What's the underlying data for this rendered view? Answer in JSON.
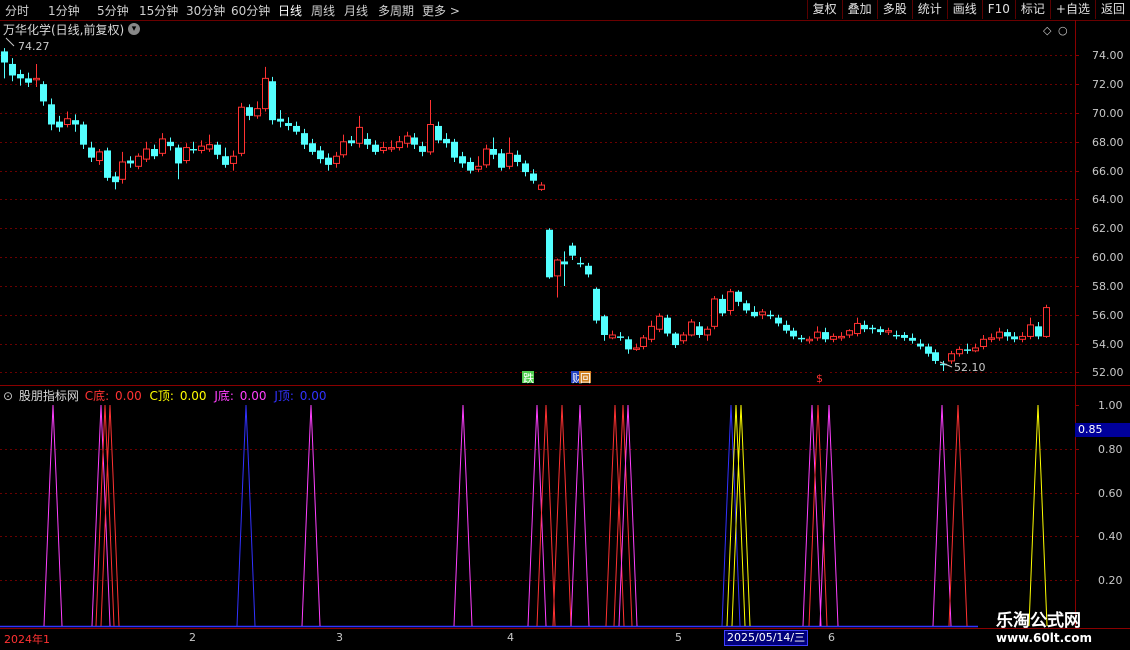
{
  "toolbar": {
    "left": [
      "分时",
      "1分钟",
      "5分钟",
      "15分钟",
      "30分钟",
      "60分钟",
      "日线",
      "周线",
      "月线",
      "多周期",
      "更多 >"
    ],
    "right": [
      "复权",
      "叠加",
      "多股",
      "统计",
      "画线",
      "F10",
      "标记",
      "+自选",
      "返回"
    ]
  },
  "chart_title": "万华化学(日线,前复权)",
  "price_axis": [
    "74.00",
    "72.00",
    "70.00",
    "68.00",
    "66.00",
    "64.00",
    "62.00",
    "60.00",
    "58.00",
    "56.00",
    "54.00",
    "52.00"
  ],
  "price_annotations": {
    "high": "74.27",
    "low": "52.10"
  },
  "event_markers": [
    "跌",
    "财",
    "回",
    "$"
  ],
  "indicator": {
    "name": "股朋指标网",
    "c_bottom_label": "C底:",
    "c_bottom_value": "0.00",
    "c_top_label": "C顶:",
    "c_top_value": "0.00",
    "j_bottom_label": "J底:",
    "j_bottom_value": "0.00",
    "j_top_label": "J顶:",
    "j_top_value": "0.00",
    "axis": [
      "1.00",
      "0.80",
      "0.60",
      "0.40",
      "0.20"
    ],
    "current_value": "0.85"
  },
  "date_axis": {
    "labels": [
      "2024年1",
      "2",
      "3",
      "4",
      "5",
      "6"
    ],
    "cursor_date": "2025/05/14/三"
  },
  "watermark": {
    "title": "乐淘公式网",
    "url": "www.60lt.com"
  },
  "colors": {
    "up": "#ff3232",
    "down": "#54ffff",
    "c_bottom": "#ff3232",
    "c_top": "#ffff00",
    "j_bottom": "#ff40ff",
    "j_top": "#3232ff"
  },
  "chart_data": {
    "type": "candlestick",
    "candles": [
      [
        74.27,
        73.5,
        74.5,
        72.4
      ],
      [
        73.4,
        72.6,
        73.8,
        72.2
      ],
      [
        72.7,
        72.4,
        73.0,
        71.9
      ],
      [
        72.4,
        72.1,
        72.8,
        71.8
      ],
      [
        72.3,
        72.4,
        73.4,
        71.8
      ],
      [
        72.0,
        70.8,
        72.2,
        70.5
      ],
      [
        70.6,
        69.2,
        71.0,
        68.8
      ],
      [
        69.4,
        69.0,
        69.8,
        68.7
      ],
      [
        69.2,
        69.6,
        70.1,
        69.0
      ],
      [
        69.5,
        69.2,
        69.9,
        68.7
      ],
      [
        69.2,
        67.8,
        69.4,
        67.5
      ],
      [
        67.6,
        66.9,
        68.0,
        66.6
      ],
      [
        66.7,
        67.3,
        67.5,
        66.4
      ],
      [
        67.4,
        65.5,
        67.6,
        65.3
      ],
      [
        65.6,
        65.2,
        65.9,
        64.7
      ],
      [
        65.4,
        66.6,
        67.3,
        65.1
      ],
      [
        66.7,
        66.5,
        67.0,
        66.2
      ],
      [
        66.3,
        67.0,
        67.2,
        66.1
      ],
      [
        66.8,
        67.5,
        68.0,
        66.6
      ],
      [
        67.5,
        67.0,
        67.8,
        66.8
      ],
      [
        67.2,
        68.2,
        68.6,
        67.0
      ],
      [
        68.0,
        67.7,
        68.3,
        67.4
      ],
      [
        67.6,
        66.5,
        67.8,
        65.4
      ],
      [
        66.7,
        67.6,
        67.9,
        66.5
      ],
      [
        67.5,
        67.4,
        68.0,
        67.2
      ],
      [
        67.4,
        67.7,
        68.1,
        67.2
      ],
      [
        67.5,
        67.8,
        68.5,
        67.3
      ],
      [
        67.8,
        67.1,
        68.0,
        66.8
      ],
      [
        67.0,
        66.4,
        67.6,
        66.2
      ],
      [
        66.5,
        67.0,
        67.4,
        66.0
      ],
      [
        67.2,
        70.4,
        70.7,
        67.0
      ],
      [
        70.4,
        69.8,
        70.6,
        69.5
      ],
      [
        69.8,
        70.3,
        70.8,
        69.6
      ],
      [
        70.3,
        72.4,
        73.2,
        70.1
      ],
      [
        72.2,
        69.5,
        72.5,
        69.2
      ],
      [
        69.6,
        69.4,
        70.2,
        69.0
      ],
      [
        69.3,
        69.1,
        69.7,
        68.8
      ],
      [
        69.1,
        68.7,
        69.4,
        68.5
      ],
      [
        68.6,
        67.8,
        68.9,
        67.5
      ],
      [
        67.9,
        67.3,
        68.2,
        67.1
      ],
      [
        67.4,
        66.8,
        67.7,
        66.5
      ],
      [
        66.9,
        66.4,
        67.2,
        66.0
      ],
      [
        66.5,
        67.0,
        67.3,
        66.2
      ],
      [
        67.1,
        68.0,
        68.5,
        66.9
      ],
      [
        68.1,
        67.9,
        68.4,
        67.7
      ],
      [
        67.9,
        69.0,
        69.8,
        67.6
      ],
      [
        68.2,
        67.8,
        68.6,
        67.5
      ],
      [
        67.8,
        67.3,
        68.1,
        67.1
      ],
      [
        67.4,
        67.6,
        68.0,
        67.2
      ],
      [
        67.5,
        67.6,
        68.1,
        67.3
      ],
      [
        67.6,
        68.0,
        68.4,
        67.4
      ],
      [
        67.9,
        68.4,
        68.7,
        67.6
      ],
      [
        68.3,
        67.8,
        68.6,
        67.5
      ],
      [
        67.7,
        67.3,
        68.0,
        67.0
      ],
      [
        67.3,
        69.2,
        70.9,
        67.1
      ],
      [
        69.1,
        68.1,
        69.4,
        67.9
      ],
      [
        68.2,
        67.9,
        68.6,
        67.6
      ],
      [
        68.0,
        66.9,
        68.2,
        66.6
      ],
      [
        67.0,
        66.5,
        67.3,
        66.2
      ],
      [
        66.6,
        66.0,
        66.9,
        65.8
      ],
      [
        66.1,
        66.3,
        67.0,
        65.9
      ],
      [
        66.4,
        67.5,
        67.8,
        66.2
      ],
      [
        67.5,
        67.1,
        68.3,
        66.8
      ],
      [
        67.2,
        66.2,
        67.5,
        66.0
      ],
      [
        66.3,
        67.2,
        68.3,
        66.1
      ],
      [
        67.1,
        66.6,
        67.4,
        66.3
      ],
      [
        66.5,
        65.9,
        66.7,
        65.6
      ],
      [
        65.8,
        65.3,
        66.1,
        65.1
      ],
      [
        64.7,
        65.0,
        65.2,
        64.6
      ],
      [
        61.9,
        58.6,
        62.0,
        58.5
      ],
      [
        58.7,
        59.8,
        59.9,
        57.2
      ],
      [
        59.7,
        59.5,
        60.4,
        58.0
      ],
      [
        60.8,
        60.1,
        61.0,
        59.8
      ],
      [
        59.6,
        59.5,
        60.0,
        59.3
      ],
      [
        59.4,
        58.8,
        59.6,
        58.6
      ],
      [
        57.8,
        55.6,
        57.9,
        55.4
      ],
      [
        55.9,
        54.6,
        56.0,
        54.2
      ],
      [
        54.4,
        54.6,
        54.9,
        54.3
      ],
      [
        54.5,
        54.4,
        54.8,
        54.2
      ],
      [
        54.3,
        53.6,
        54.5,
        53.3
      ],
      [
        53.6,
        53.7,
        54.0,
        53.5
      ],
      [
        53.8,
        54.4,
        54.6,
        53.6
      ],
      [
        54.3,
        55.2,
        55.6,
        54.1
      ],
      [
        55.0,
        55.9,
        56.1,
        54.8
      ],
      [
        55.8,
        54.7,
        56.0,
        54.5
      ],
      [
        54.7,
        53.9,
        54.8,
        53.7
      ],
      [
        54.2,
        54.6,
        54.8,
        54.0
      ],
      [
        54.6,
        55.5,
        55.7,
        54.5
      ],
      [
        55.2,
        54.6,
        55.5,
        54.4
      ],
      [
        54.6,
        55.0,
        55.2,
        54.2
      ],
      [
        55.2,
        57.1,
        57.3,
        55.0
      ],
      [
        57.1,
        56.1,
        57.4,
        55.9
      ],
      [
        56.3,
        57.6,
        57.8,
        56.0
      ],
      [
        57.6,
        56.9,
        57.7,
        56.6
      ],
      [
        56.8,
        56.3,
        57.0,
        56.1
      ],
      [
        56.2,
        55.9,
        56.6,
        55.8
      ],
      [
        56.0,
        56.2,
        56.4,
        55.7
      ],
      [
        56.0,
        55.9,
        56.3,
        55.7
      ],
      [
        55.8,
        55.4,
        56.0,
        55.2
      ],
      [
        55.3,
        54.9,
        55.6,
        54.7
      ],
      [
        54.9,
        54.5,
        55.1,
        54.3
      ],
      [
        54.4,
        54.3,
        54.6,
        54.1
      ],
      [
        54.2,
        54.3,
        54.5,
        54.0
      ],
      [
        54.4,
        54.8,
        55.2,
        54.2
      ],
      [
        54.8,
        54.3,
        55.1,
        54.1
      ],
      [
        54.3,
        54.5,
        54.7,
        54.1
      ],
      [
        54.4,
        54.5,
        54.8,
        54.2
      ],
      [
        54.6,
        54.9,
        55.0,
        54.4
      ],
      [
        54.7,
        55.4,
        55.8,
        54.5
      ],
      [
        55.3,
        55.0,
        55.6,
        54.8
      ],
      [
        55.1,
        55.0,
        55.3,
        54.7
      ],
      [
        55.0,
        54.8,
        55.2,
        54.6
      ],
      [
        54.8,
        54.9,
        55.1,
        54.6
      ],
      [
        54.6,
        54.5,
        54.9,
        54.3
      ],
      [
        54.6,
        54.4,
        54.8,
        54.2
      ],
      [
        54.4,
        54.2,
        54.7,
        54.0
      ],
      [
        54.0,
        53.8,
        54.3,
        53.6
      ],
      [
        53.8,
        53.3,
        54.0,
        53.1
      ],
      [
        53.4,
        52.8,
        53.6,
        52.6
      ],
      [
        52.6,
        52.5,
        52.8,
        52.1
      ],
      [
        52.8,
        53.3,
        53.5,
        52.6
      ],
      [
        53.3,
        53.6,
        53.8,
        53.1
      ],
      [
        53.6,
        53.5,
        54.0,
        53.3
      ],
      [
        53.5,
        53.7,
        54.0,
        53.4
      ],
      [
        53.8,
        54.3,
        54.6,
        53.6
      ],
      [
        54.3,
        54.4,
        54.7,
        54.1
      ],
      [
        54.4,
        54.8,
        55.1,
        54.2
      ],
      [
        54.8,
        54.5,
        55.0,
        54.2
      ],
      [
        54.5,
        54.3,
        54.8,
        54.1
      ],
      [
        54.3,
        54.5,
        54.8,
        54.1
      ],
      [
        54.5,
        55.3,
        55.8,
        54.3
      ],
      [
        55.2,
        54.5,
        55.5,
        54.3
      ],
      [
        54.5,
        56.5,
        56.7,
        54.4
      ]
    ],
    "indicator_spikes": [
      {
        "series": "J底",
        "x": 53,
        "v": 1.0
      },
      {
        "series": "J底",
        "x": 101,
        "v": 1.0
      },
      {
        "series": "C底",
        "x": 105,
        "v": 1.0
      },
      {
        "series": "C底",
        "x": 110,
        "v": 1.0
      },
      {
        "series": "J顶",
        "x": 246,
        "v": 1.0
      },
      {
        "series": "J底",
        "x": 311,
        "v": 1.0
      },
      {
        "series": "J底",
        "x": 463,
        "v": 1.0
      },
      {
        "series": "J底",
        "x": 537,
        "v": 1.0
      },
      {
        "series": "C底",
        "x": 546,
        "v": 1.0
      },
      {
        "series": "C底",
        "x": 562,
        "v": 1.0
      },
      {
        "series": "J底",
        "x": 580,
        "v": 1.0
      },
      {
        "series": "C底",
        "x": 615,
        "v": 1.0
      },
      {
        "series": "C底",
        "x": 623,
        "v": 1.0
      },
      {
        "series": "J底",
        "x": 628,
        "v": 1.0
      },
      {
        "series": "J顶",
        "x": 731,
        "v": 1.0
      },
      {
        "series": "C顶",
        "x": 736,
        "v": 1.0
      },
      {
        "series": "C顶",
        "x": 741,
        "v": 1.0
      },
      {
        "series": "J底",
        "x": 812,
        "v": 1.0
      },
      {
        "series": "C底",
        "x": 818,
        "v": 1.0
      },
      {
        "series": "J底",
        "x": 829,
        "v": 1.0
      },
      {
        "series": "J底",
        "x": 942,
        "v": 1.0
      },
      {
        "series": "C底",
        "x": 958,
        "v": 1.0
      },
      {
        "series": "C顶",
        "x": 1038,
        "v": 1.0
      }
    ],
    "ylim": [
      51.2,
      75.2
    ]
  }
}
